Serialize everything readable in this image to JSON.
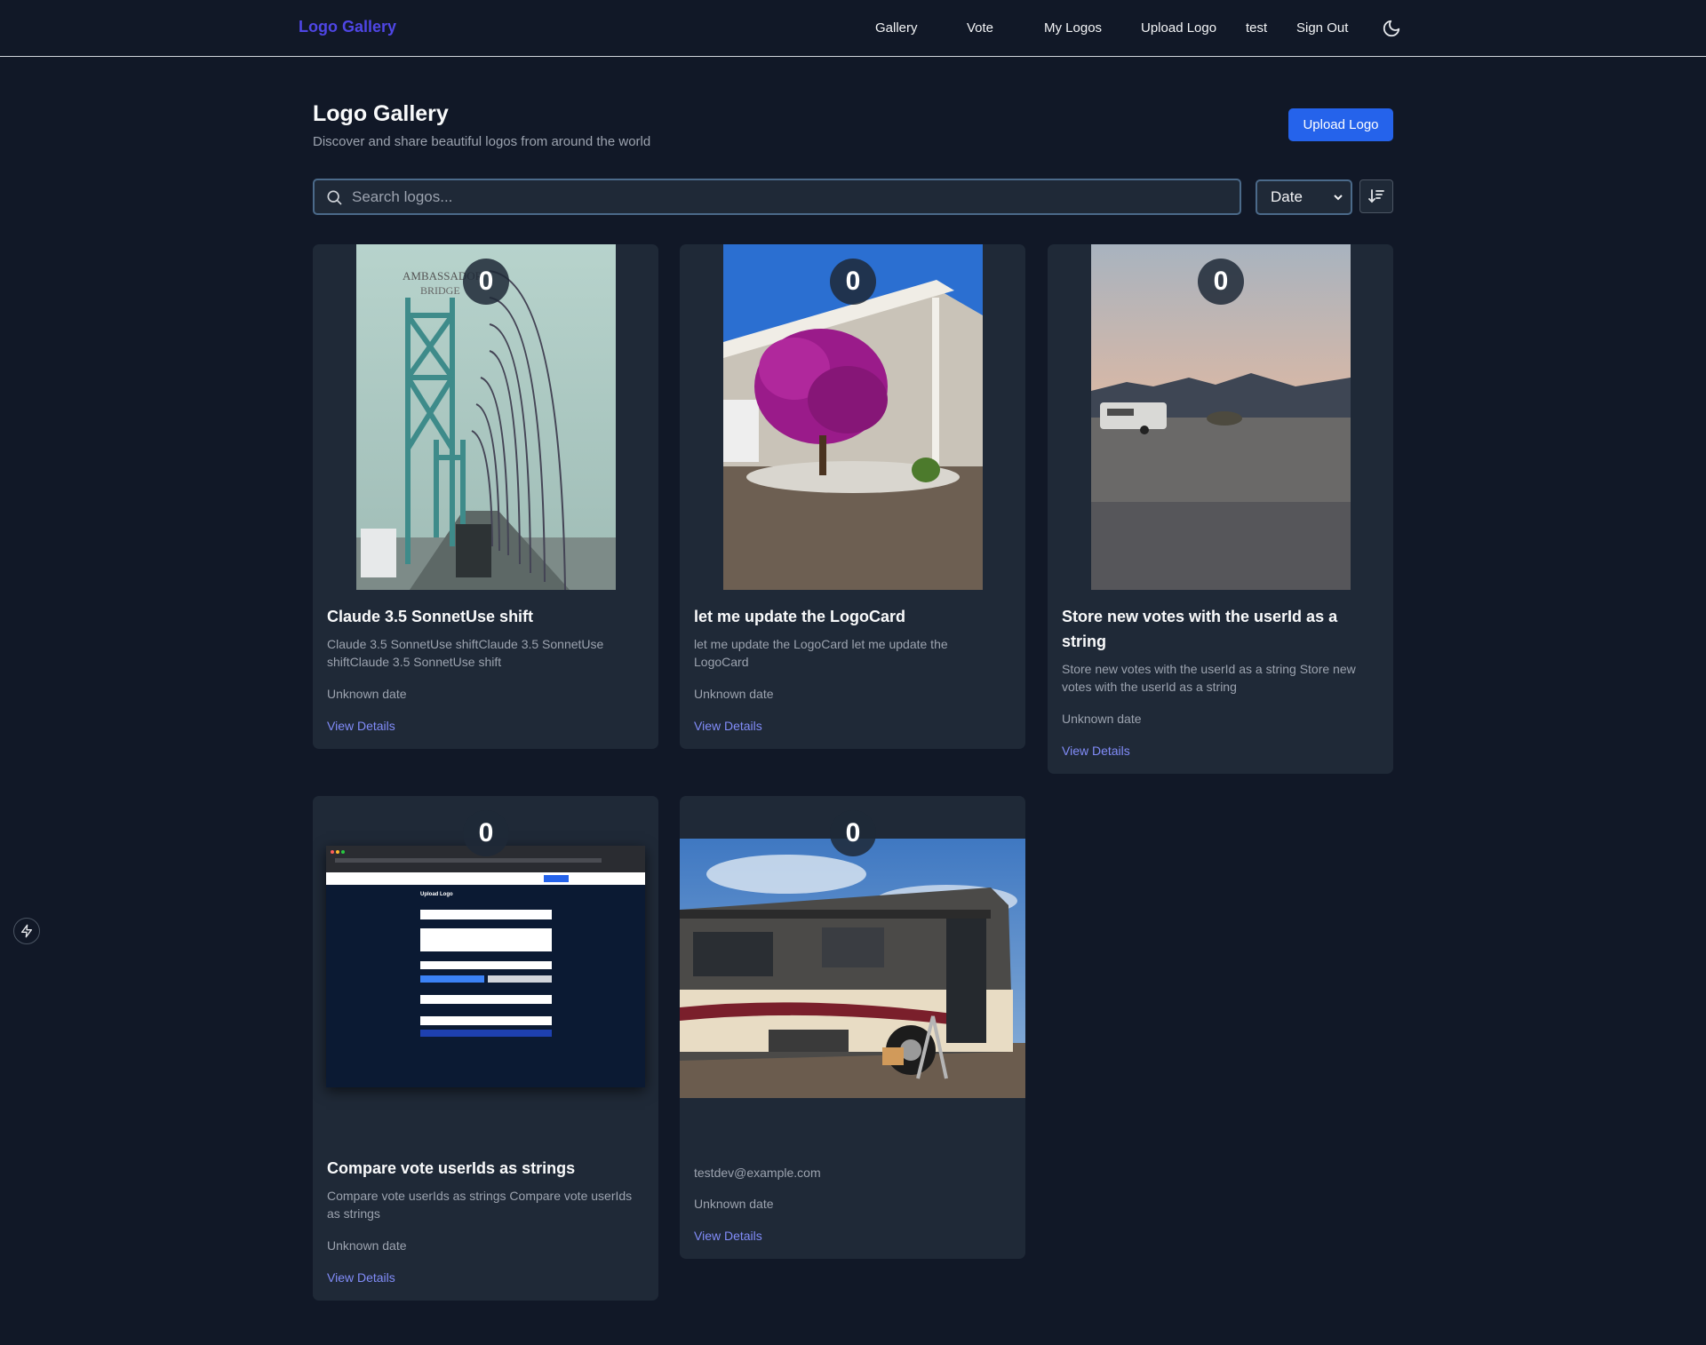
{
  "nav": {
    "brand": "Logo Gallery",
    "links": [
      "Gallery",
      "Vote",
      "My Logos",
      "Upload Logo",
      "test",
      "Sign Out"
    ]
  },
  "header": {
    "title": "Logo Gallery",
    "subtitle": "Discover and share beautiful logos from around the world",
    "upload_label": "Upload Logo"
  },
  "search": {
    "placeholder": "Search logos..."
  },
  "sort": {
    "selected": "Date"
  },
  "cards": [
    {
      "votes": "0",
      "title": "Claude 3.5 SonnetUse shift",
      "description": "Claude 3.5 SonnetUse shiftClaude 3.5 SonnetUse shiftClaude 3.5 SonnetUse shift",
      "date": "Unknown date",
      "link": "View Details"
    },
    {
      "votes": "0",
      "title": "let me update the LogoCard",
      "description": "let me update the LogoCard let me update the LogoCard",
      "date": "Unknown date",
      "link": "View Details"
    },
    {
      "votes": "0",
      "title": "Store new votes with the userId as a string",
      "description": "Store new votes with the userId as a string Store new votes with the userId as a string",
      "date": "Unknown date",
      "link": "View Details"
    },
    {
      "votes": "0",
      "title": "Compare vote userIds as strings",
      "description": "Compare vote userIds as strings Compare vote userIds as strings",
      "date": "Unknown date",
      "link": "View Details"
    },
    {
      "votes": "0",
      "title": "",
      "description": "testdev@example.com",
      "date": "Unknown date",
      "link": "View Details"
    }
  ],
  "screenshot_thumb": {
    "title": "Upload Logo"
  },
  "colors": {
    "accent": "#2563eb",
    "brand": "#4f46e5",
    "link": "#818cf8",
    "background": "#111827",
    "card": "#1f2937"
  },
  "icons": [
    "moon-icon",
    "search-icon",
    "chevron-down-icon",
    "sort-descending-icon",
    "lightning-icon"
  ]
}
